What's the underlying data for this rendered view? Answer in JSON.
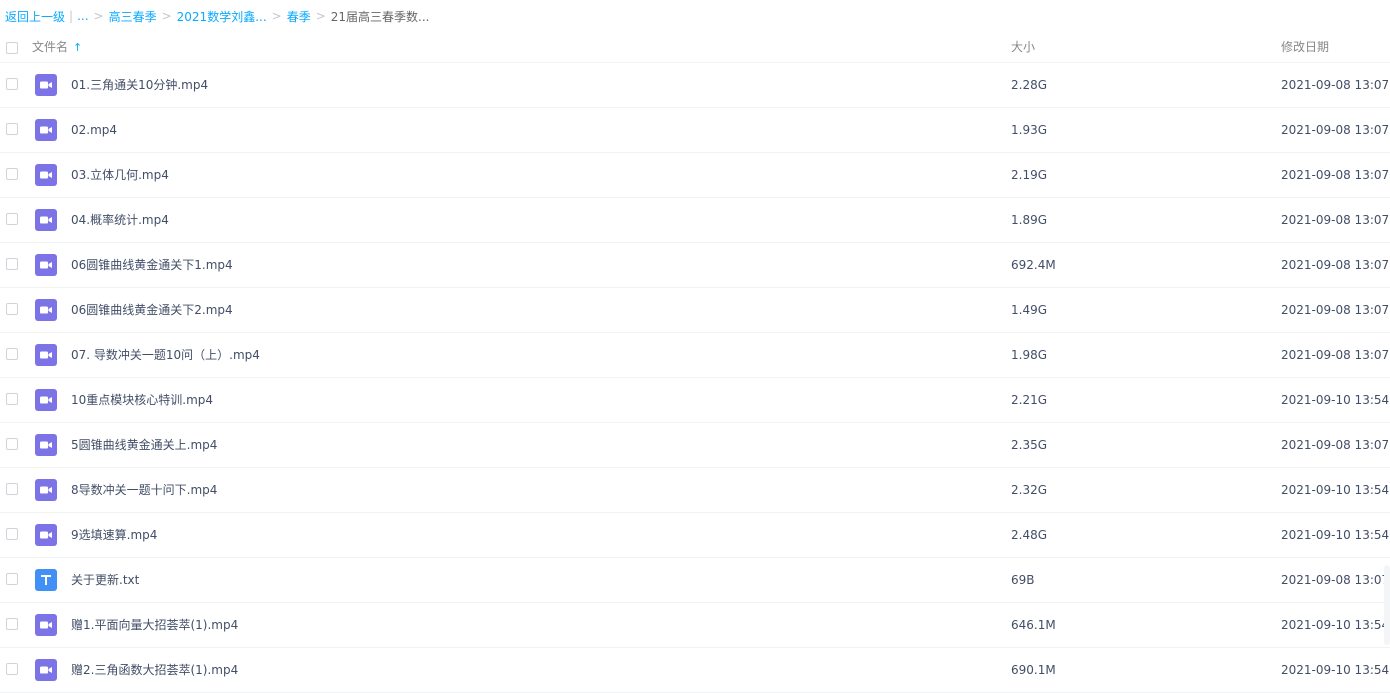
{
  "breadcrumb": {
    "back": "返回上一级",
    "ellipsis": "...",
    "crumbs": [
      "高三春季",
      "2021数学刘鑫...",
      "春季"
    ],
    "current": "21届高三春季数..."
  },
  "columns": {
    "name": "文件名",
    "sort_icon": "arrow-up-icon",
    "size": "大小",
    "date": "修改日期"
  },
  "colors": {
    "link": "#09aaff",
    "video_icon": "#7c73e6",
    "text_icon": "#4190f5"
  },
  "files": [
    {
      "name": "01.三角通关10分钟.mp4",
      "size": "2.28G",
      "date": "2021-09-08 13:07",
      "icon": "video-file-icon"
    },
    {
      "name": "02.mp4",
      "size": "1.93G",
      "date": "2021-09-08 13:07",
      "icon": "video-file-icon"
    },
    {
      "name": "03.立体几何.mp4",
      "size": "2.19G",
      "date": "2021-09-08 13:07",
      "icon": "video-file-icon"
    },
    {
      "name": "04.概率统计.mp4",
      "size": "1.89G",
      "date": "2021-09-08 13:07",
      "icon": "video-file-icon"
    },
    {
      "name": "06圆锥曲线黄金通关下1.mp4",
      "size": "692.4M",
      "date": "2021-09-08 13:07",
      "icon": "video-file-icon"
    },
    {
      "name": "06圆锥曲线黄金通关下2.mp4",
      "size": "1.49G",
      "date": "2021-09-08 13:07",
      "icon": "video-file-icon"
    },
    {
      "name": "07. 导数冲关一题10问（上）.mp4",
      "size": "1.98G",
      "date": "2021-09-08 13:07",
      "icon": "video-file-icon"
    },
    {
      "name": "10重点模块核心特训.mp4",
      "size": "2.21G",
      "date": "2021-09-10 13:54",
      "icon": "video-file-icon"
    },
    {
      "name": "5圆锥曲线黄金通关上.mp4",
      "size": "2.35G",
      "date": "2021-09-08 13:07",
      "icon": "video-file-icon"
    },
    {
      "name": "8导数冲关一题十问下.mp4",
      "size": "2.32G",
      "date": "2021-09-10 13:54",
      "icon": "video-file-icon"
    },
    {
      "name": "9选填速算.mp4",
      "size": "2.48G",
      "date": "2021-09-10 13:54",
      "icon": "video-file-icon"
    },
    {
      "name": "关于更新.txt",
      "size": "69B",
      "date": "2021-09-08 13:07",
      "icon": "text-file-icon"
    },
    {
      "name": "赠1.平面向量大招荟萃(1).mp4",
      "size": "646.1M",
      "date": "2021-09-10 13:54",
      "icon": "video-file-icon"
    },
    {
      "name": "赠2.三角函数大招荟萃(1).mp4",
      "size": "690.1M",
      "date": "2021-09-10 13:54",
      "icon": "video-file-icon"
    }
  ]
}
